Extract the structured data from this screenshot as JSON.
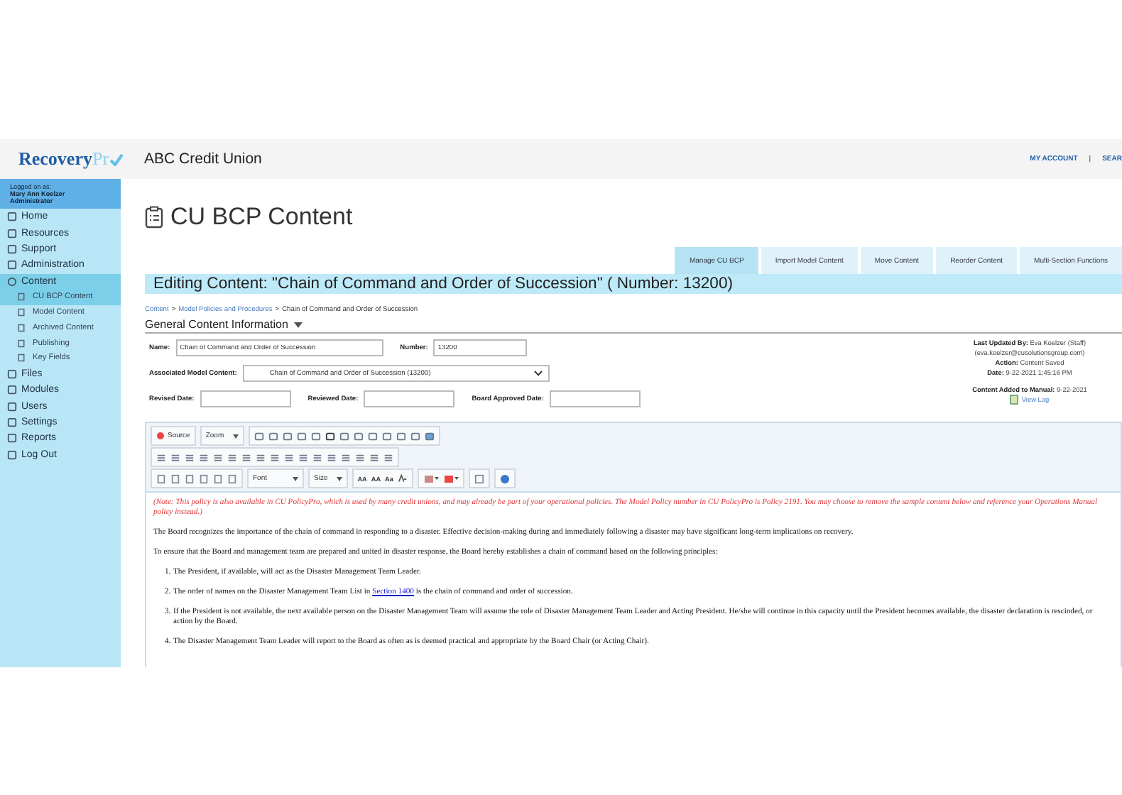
{
  "header": {
    "logo_main": "Recovery",
    "logo_accent": "Pr",
    "org_name": "ABC Credit Union",
    "links": [
      "MY ACCOUNT",
      "|",
      "SEAR"
    ]
  },
  "sidebar": {
    "logged_label": "Logged on as:",
    "user_name": "Mary Ann Koelzer",
    "role": "Administrator",
    "items": [
      {
        "label": "Home",
        "selected": false
      },
      {
        "label": "Resources",
        "selected": false
      },
      {
        "label": "Support",
        "selected": false
      },
      {
        "label": "Administration",
        "selected": false
      },
      {
        "label": "Content",
        "selected": true,
        "expanded": true,
        "children": [
          {
            "label": "CU BCP Content",
            "selected": true
          },
          {
            "label": "Model Content",
            "selected": false
          },
          {
            "label": "Archived Content",
            "selected": false
          },
          {
            "label": "Publishing",
            "selected": false
          },
          {
            "label": "Key Fields",
            "selected": false
          }
        ]
      },
      {
        "label": "Files",
        "selected": false
      },
      {
        "label": "Modules",
        "selected": false
      },
      {
        "label": "Users",
        "selected": false
      },
      {
        "label": "Settings",
        "selected": false
      },
      {
        "label": "Reports",
        "selected": false
      },
      {
        "label": "Log Out",
        "selected": false
      }
    ]
  },
  "page_title": "CU BCP Content",
  "tabs": [
    {
      "label": "Manage CU BCP",
      "selected": true
    },
    {
      "label": "Import Model Content",
      "selected": false
    },
    {
      "label": "Move Content",
      "selected": false
    },
    {
      "label": "Reorder Content",
      "selected": false
    },
    {
      "label": "Multi-Section Functions",
      "selected": false
    }
  ],
  "editing_title": "Editing Content: \"Chain of Command and Order of Succession\" ( Number: 13200)",
  "breadcrumb_separator": ">",
  "breadcrumb": [
    "Content",
    "Model Policies and Procedures",
    "Chain of Command and Order of Succession"
  ],
  "section_title": "General Content Information",
  "form": {
    "name_label": "Name:",
    "name_value": "Chain of Command and Order of Succession",
    "number_label": "Number:",
    "number_value": "13200",
    "assoc_label": "Associated Model Content:",
    "assoc_value": "Chain of Command and Order of Succession (13200)",
    "revised_label": "Revised Date:",
    "reviewed_label": "Reviewed Date:",
    "approved_label": "Board Approved Date:"
  },
  "info": {
    "updated_label": "Last Updated By:",
    "updated_value": "Eva Koelzer (Staff)",
    "email": "(eva.koelzer@cusolutionsgroup.com)",
    "action_label": "Action:",
    "action_value": "Content Saved",
    "date_label": "Date:",
    "date_value": "9-22-2021 1:45:16 PM",
    "added_label": "Content Added to Manual:",
    "added_value": "9-22-2021",
    "view_log": "View Log"
  },
  "toolbar": {
    "source": "Source",
    "zoom": "Zoom",
    "font": "Font",
    "size": "Size",
    "case_buttons": [
      "AA",
      "AA",
      "Aa"
    ]
  },
  "editor": {
    "note": "(Note: This policy is also available in CU PolicyPro, which is used by many credit unions, and may already be part of your operational policies.  The Model Policy number in CU PolicyPro is Policy 2191.  You may choose to remove the sample content below and reference your Operations Manual policy instead.)",
    "paragraphs": [
      "The Board recognizes the importance of the chain of command in responding to a disaster. Effective decision-making during and immediately following a disaster may have significant long-term implications on recovery.",
      "To ensure that the Board and management team are prepared and united in disaster response, the Board hereby establishes a chain of command based on the following principles:"
    ],
    "list": [
      {
        "marker": "1.",
        "text": "The President, if available, will act as the Disaster Management Team Leader."
      },
      {
        "marker": "2.",
        "text": "The order of names on the Disaster Management Team List in ",
        "link": "Section 1400",
        "after": " is the chain of command and order of succession."
      },
      {
        "marker": "3.",
        "text": "If the President is not available, the next available person on the Disaster Management Team will assume the role of Disaster Management Team Leader and Acting President. He/she will continue in this capacity until the President becomes available, the disaster declaration is rescinded, or action by the Board."
      },
      {
        "marker": "4.",
        "text": "The Disaster Management Team Leader will report to the Board as often as is deemed practical and appropriate by the Board Chair (or Acting Chair)."
      }
    ]
  }
}
